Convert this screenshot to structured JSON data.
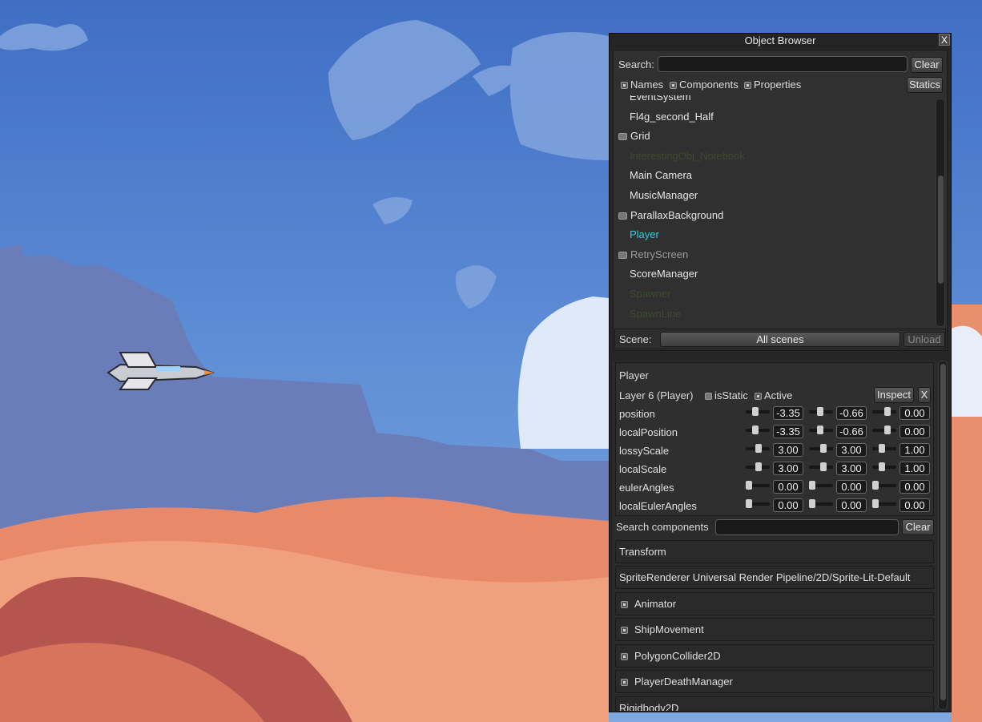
{
  "window": {
    "title": "Object Browser",
    "close_label": "X"
  },
  "search": {
    "label": "Search:",
    "value": "",
    "clear_label": "Clear",
    "filters": [
      {
        "label": "Names",
        "checked": true
      },
      {
        "label": "Components",
        "checked": true
      },
      {
        "label": "Properties",
        "checked": true
      }
    ],
    "statics_label": "Statics"
  },
  "objects": [
    {
      "name": "EventSystem",
      "color": "#e6e6e6",
      "toggle": false
    },
    {
      "name": "Fl4g_second_Half",
      "color": "#e6e6e6",
      "toggle": false
    },
    {
      "name": "Grid",
      "color": "#e6e6e6",
      "toggle": true
    },
    {
      "name": "InterestingObj_Notebook",
      "color": "#3d4a2e",
      "toggle": false
    },
    {
      "name": "Main Camera",
      "color": "#e6e6e6",
      "toggle": false
    },
    {
      "name": "MusicManager",
      "color": "#e6e6e6",
      "toggle": false
    },
    {
      "name": "ParallaxBackground",
      "color": "#e6e6e6",
      "toggle": true
    },
    {
      "name": "Player",
      "color": "#2fd0e0",
      "toggle": false
    },
    {
      "name": "RetryScreen",
      "color": "#9a9a9a",
      "toggle": true
    },
    {
      "name": "ScoreManager",
      "color": "#e6e6e6",
      "toggle": false
    },
    {
      "name": "Spawner",
      "color": "#3d4a2e",
      "toggle": false
    },
    {
      "name": "SpawnLine",
      "color": "#3d4a2e",
      "toggle": false
    }
  ],
  "scene": {
    "label": "Scene:",
    "value": "All scenes",
    "unload_label": "Unload"
  },
  "inspector": {
    "object_name": "Player",
    "layer": "Layer 6 (Player)",
    "is_static_label": "isStatic",
    "is_static": false,
    "active_label": "Active",
    "active": true,
    "inspect_label": "Inspect",
    "close_label": "X",
    "transform_rows": [
      {
        "label": "position",
        "values": [
          "-3.35",
          "-0.66",
          "0.00"
        ]
      },
      {
        "label": "localPosition",
        "values": [
          "-3.35",
          "-0.66",
          "0.00"
        ]
      },
      {
        "label": "lossyScale",
        "values": [
          "3.00",
          "3.00",
          "1.00"
        ]
      },
      {
        "label": "localScale",
        "values": [
          "3.00",
          "3.00",
          "1.00"
        ]
      },
      {
        "label": "eulerAngles",
        "values": [
          "0.00",
          "0.00",
          "0.00"
        ]
      },
      {
        "label": "localEulerAngles",
        "values": [
          "0.00",
          "0.00",
          "0.00"
        ]
      }
    ],
    "search_components_label": "Search components",
    "search_components_value": "",
    "search_clear_label": "Clear",
    "components": [
      {
        "name": "Transform",
        "toggle": false
      },
      {
        "name": "SpriteRenderer  Universal Render Pipeline/2D/Sprite-Lit-Default",
        "toggle": false
      },
      {
        "name": "Animator",
        "toggle": true
      },
      {
        "name": "ShipMovement",
        "toggle": true
      },
      {
        "name": "PolygonCollider2D",
        "toggle": true
      },
      {
        "name": "PlayerDeathManager",
        "toggle": true
      },
      {
        "name": "Rigidbody2D",
        "toggle": false
      }
    ]
  }
}
